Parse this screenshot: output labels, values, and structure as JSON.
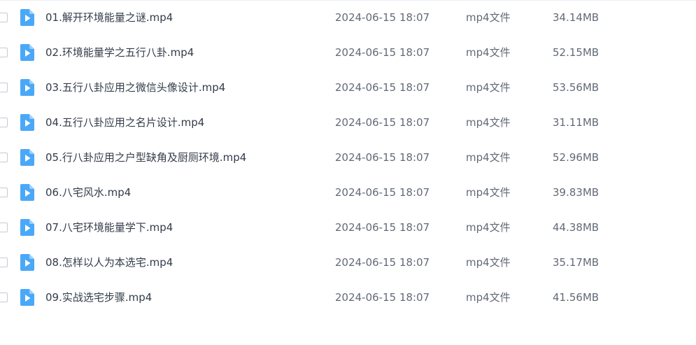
{
  "colors": {
    "icon_blue": "#4aa8f8",
    "icon_fold": "#9dd0fb",
    "name_text": "#333c4a",
    "meta_text": "#626a77"
  },
  "icon": "video-file-icon",
  "files": [
    {
      "name": "01.解开环境能量之谜.mp4",
      "date": "2024-06-15 18:07",
      "type": "mp4文件",
      "size": "34.14MB"
    },
    {
      "name": "02.环境能量学之五行八卦.mp4",
      "date": "2024-06-15 18:07",
      "type": "mp4文件",
      "size": "52.15MB"
    },
    {
      "name": "03.五行八卦应用之微信头像设计.mp4",
      "date": "2024-06-15 18:07",
      "type": "mp4文件",
      "size": "53.56MB"
    },
    {
      "name": "04.五行八卦应用之名片设计.mp4",
      "date": "2024-06-15 18:07",
      "type": "mp4文件",
      "size": "31.11MB"
    },
    {
      "name": "05.行八卦应用之户型缺角及厨厕环境.mp4",
      "date": "2024-06-15 18:07",
      "type": "mp4文件",
      "size": "52.96MB"
    },
    {
      "name": "06.八宅风水.mp4",
      "date": "2024-06-15 18:07",
      "type": "mp4文件",
      "size": "39.83MB"
    },
    {
      "name": "07.八宅环境能量学下.mp4",
      "date": "2024-06-15 18:07",
      "type": "mp4文件",
      "size": "44.38MB"
    },
    {
      "name": "08.怎样以人为本选宅.mp4",
      "date": "2024-06-15 18:07",
      "type": "mp4文件",
      "size": "35.17MB"
    },
    {
      "name": "09.实战选宅步骤.mp4",
      "date": "2024-06-15 18:07",
      "type": "mp4文件",
      "size": "41.56MB"
    }
  ]
}
